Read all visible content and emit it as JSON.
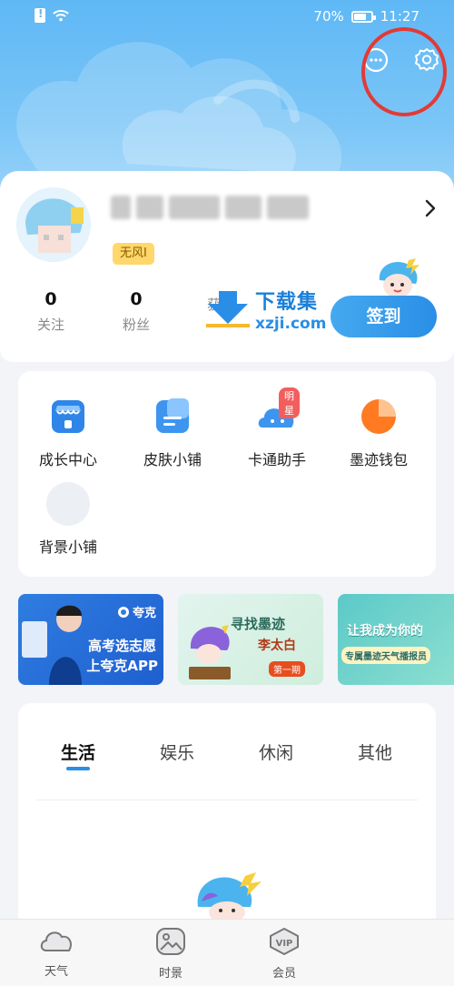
{
  "status_bar": {
    "battery": "70%",
    "battery_level": 0.7,
    "time": "11:27"
  },
  "profile": {
    "tag": "无风I",
    "stats": [
      {
        "value": "0",
        "label": "关注"
      },
      {
        "value": "0",
        "label": "粉丝"
      },
      {
        "value": "",
        "label": "获赞"
      }
    ],
    "checkin_label": "签到"
  },
  "watermark": {
    "brand": "下载集",
    "domain": "xzji.com"
  },
  "tools": [
    {
      "label": "成长中心",
      "icon": "store-icon"
    },
    {
      "label": "皮肤小铺",
      "icon": "document-icon"
    },
    {
      "label": "卡通助手",
      "icon": "cloud-assistant-icon",
      "badge": "明星"
    },
    {
      "label": "墨迹钱包",
      "icon": "wallet-pie-icon"
    },
    {
      "label": "背景小铺",
      "icon": "placeholder-circle-icon"
    }
  ],
  "banners": [
    {
      "logo": "夸克",
      "line1": "高考选志愿",
      "line2": "上夸克APP"
    },
    {
      "line1": "寻找墨迹",
      "line2": "李太白",
      "badge": "第一期"
    },
    {
      "line1": "让我成为你的",
      "line2": "专属墨迹天气播报员"
    }
  ],
  "feed_tabs": [
    "生活",
    "娱乐",
    "休闲",
    "其他"
  ],
  "bottom_nav": [
    {
      "label": "天气",
      "icon": "cloud-icon"
    },
    {
      "label": "时景",
      "icon": "photo-icon"
    },
    {
      "label": "会员",
      "icon": "vip-icon"
    }
  ],
  "colors": {
    "accent": "#2a8ee6",
    "header_sky": "#5fb8f5",
    "annotation_red": "#e23a35"
  }
}
